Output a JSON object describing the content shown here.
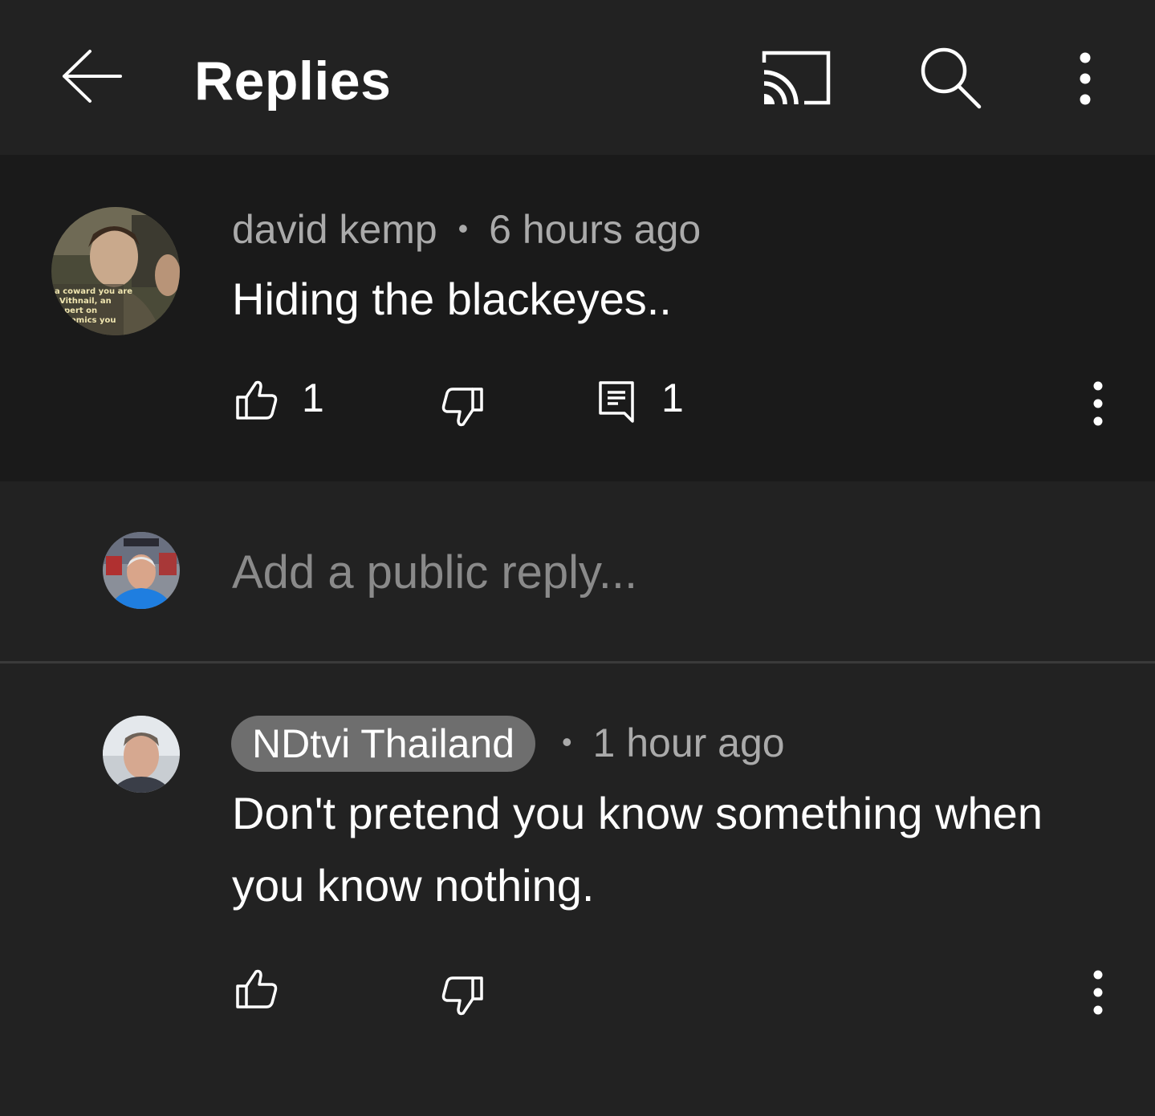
{
  "header": {
    "title": "Replies"
  },
  "parent_comment": {
    "author": "david kemp",
    "separator": "•",
    "time": "6 hours ago",
    "text": "Hiding the blackeyes..",
    "like_count": "1",
    "reply_count": "1"
  },
  "reply_box": {
    "placeholder": "Add a public reply..."
  },
  "reply_comment": {
    "author": "NDtvi Thailand",
    "separator": "•",
    "time": "1 hour ago",
    "text": "Don't pretend you know something when you know nothing."
  },
  "icons": [
    "back-arrow-icon",
    "cast-icon",
    "search-icon",
    "more-vert-icon",
    "thumb-up-icon",
    "thumb-down-icon",
    "comment-icon"
  ]
}
